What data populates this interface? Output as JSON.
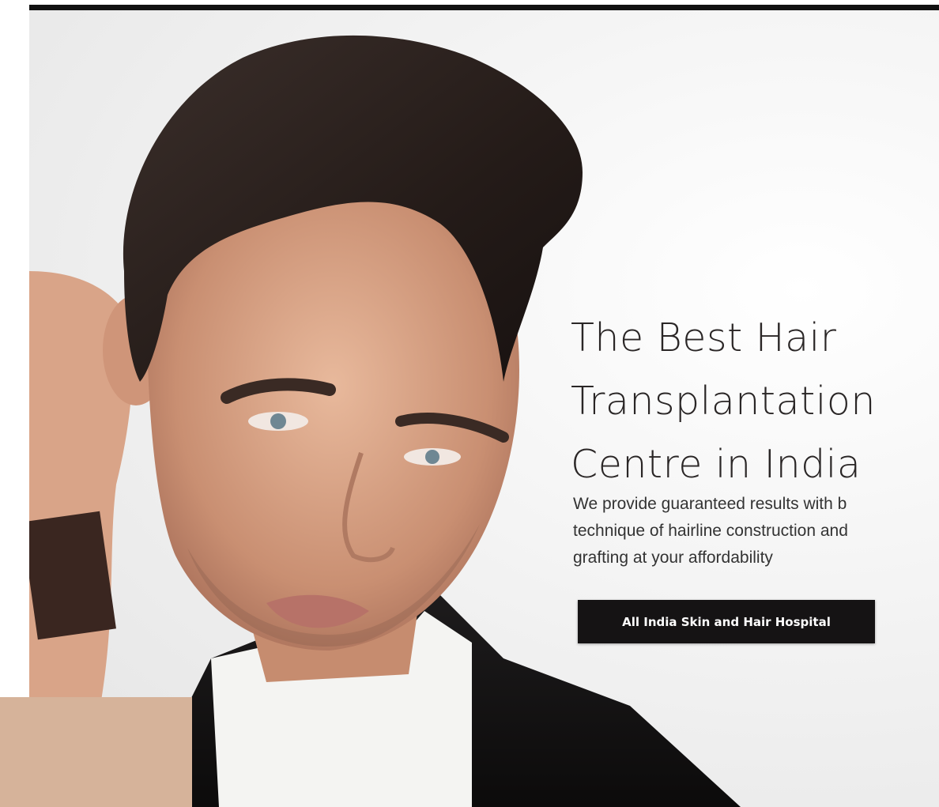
{
  "hero": {
    "headline_lines": [
      "The Best Hair",
      "Transplantation",
      "Centre in India"
    ],
    "description_lines": [
      "We provide guaranteed results with b",
      "technique of hairline construction and",
      "grafting at your affordability"
    ],
    "cta_label": "All India Skin and Hair Hospital"
  },
  "colors": {
    "top_bar": "#111111",
    "cta_background": "#151314",
    "accent_block": "#d6b39a",
    "headline_text": "#2a2626"
  }
}
